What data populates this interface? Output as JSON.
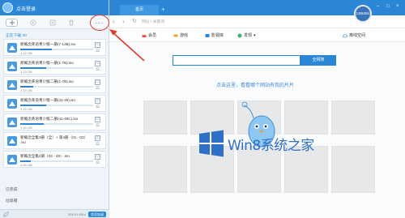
{
  "app": {
    "title": "点击登录",
    "toolbar": {
      "more_label": "···"
    },
    "downloading_label": "正在下载 30",
    "completed_label": "已完成",
    "trash_label": "垃圾箱",
    "footer": {
      "speed": "535.91 KB/s",
      "vip_label": "会员加速"
    }
  },
  "downloads": [
    {
      "name": "新概念英语青少版一册(7-14B).iso",
      "size": "1.12 GB",
      "progress": 0.43
    },
    {
      "name": "新概念英语青少版一册(1-7B).iso",
      "size": "1.13 GB",
      "progress": 0.36
    },
    {
      "name": "新概念英语青少版二册(1-7B).iso",
      "size": "1.19 GB",
      "progress": 0.18
    },
    {
      "name": "新概念英语青少版一册(41-48).iso",
      "size": "1.15 GB",
      "progress": 0.35
    },
    {
      "name": "新概念英语青少版二册(41-49C).iso",
      "size": "1.15 GB",
      "progress": 0.32
    },
    {
      "name": "新概念全集3册（全）+ 第4册（01 - 03）",
      "name2": ".iso",
      "size": "",
      "progress": 0
    },
    {
      "name": "新概念全集4册（04 - 48）.iso",
      "size": "0.99 GB",
      "progress": 0.14
    }
  ],
  "browser": {
    "tab_label": "首页",
    "speed_badge": "136KB/s",
    "address_placeholder": "网址 / 关键词",
    "nav": [
      {
        "label": "会员",
        "icon": "crown-icon"
      },
      {
        "label": "游戏",
        "icon": "gamepad-icon"
      },
      {
        "label": "影视库",
        "icon": "film-icon"
      },
      {
        "label": "发现",
        "icon": "compass-icon"
      },
      {
        "label": "离线空间",
        "icon": "cloud-icon"
      }
    ],
    "search_button": "全网搜",
    "promo_text": "点击这里，看看哪个网站有我的片片"
  },
  "watermark": {
    "text": "Win8系统之家"
  },
  "colors": {
    "accent": "#2b87d6",
    "annotation": "#e23a2e",
    "watermark": "#2f6fc5"
  }
}
